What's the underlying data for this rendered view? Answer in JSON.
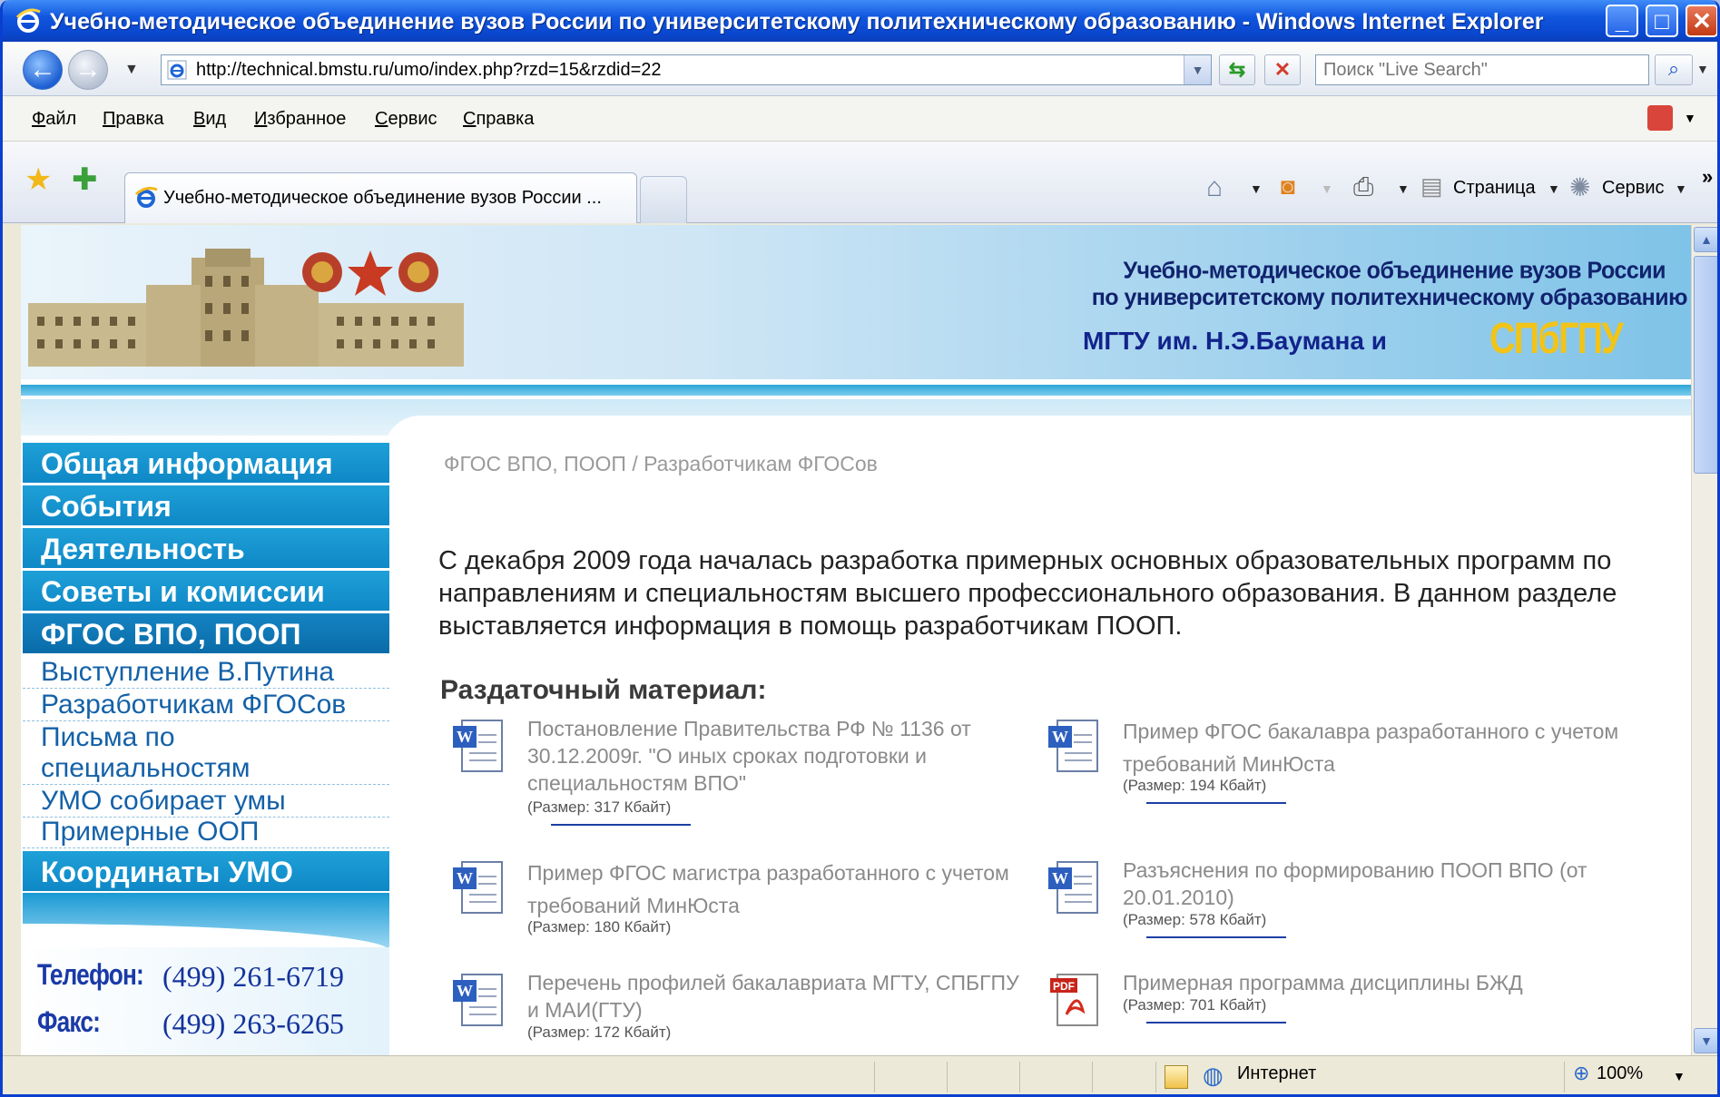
{
  "window": {
    "title": "Учебно-методическое объединение вузов России по университетскому политехническому образованию - Windows Internet Explorer",
    "min": "_",
    "max": "□",
    "close": "✕"
  },
  "address": {
    "url": "http://technical.bmstu.ru/umo/index.php?rzd=15&rzdid=22",
    "search_placeholder": "Поиск \"Live Search\""
  },
  "menu": [
    "Файл",
    "Правка",
    "Вид",
    "Избранное",
    "Сервис",
    "Справка"
  ],
  "tab": {
    "label": "Учебно-методическое объединение вузов России ..."
  },
  "commandbar": {
    "page": "Страница",
    "tools": "Сервис",
    "more": "»"
  },
  "banner": {
    "line1": "Учебно-методическое объединение вузов России",
    "line2": "по университетскому политехническому образованию",
    "line3": "МГТУ им. Н.Э.Баумана   и",
    "logo": "СПбГПУ"
  },
  "sidebar": {
    "nav": [
      "Общая информация",
      "События",
      "Деятельность",
      "Советы и комиссии",
      "ФГОС ВПО, ПООП"
    ],
    "sub": [
      "Выступление В.Путина",
      "Разработчикам ФГОСов",
      "Письма по",
      "специальностям",
      "УМО собирает умы",
      "Примерные ООП"
    ],
    "coords": "Координаты УМО",
    "phone_label": "Телефон:",
    "phone": "(499) 261-6719",
    "fax_label": "Факс:",
    "fax": "(499) 263-6265"
  },
  "main": {
    "breadcrumb": "ФГОС ВПО, ПООП / Разработчикам ФГОСов",
    "intro": "С декабря 2009 года началась разработка примерных основных образовательных программ по направлениям и специальностям высшего профессионального образования. В данном разделе выставляется информация в помощь разработчикам ПООП.",
    "materials_heading": "Раздаточный материал:",
    "docs": [
      {
        "title": "Постановление Правительства РФ № 1136 от 30.12.2009г. \"О иных сроках подготовки и специальностям ВПО\"",
        "size": "(Размер: 317 Кбайт)",
        "type": "word"
      },
      {
        "title": "Пример ФГОС бакалавра разработанного с учетом требований МинЮста",
        "size": "(Размер: 194 Кбайт)",
        "type": "word"
      },
      {
        "title": "Пример ФГОС магистра разработанного с учетом требований МинЮста",
        "size": "(Размер: 180 Кбайт)",
        "type": "word"
      },
      {
        "title": "Разъяснения по формированию ПООП ВПО (от 20.01.2010)",
        "size": "(Размер: 578 Кбайт)",
        "type": "word"
      },
      {
        "title": "Перечень профилей бакалавриата МГТУ, СПБГПУ и МАИ(ГТУ)",
        "size": "(Размер: 172 Кбайт)",
        "type": "word"
      },
      {
        "title": "Примерная программа дисциплины БЖД",
        "size": "(Размер: 701 Кбайт)",
        "type": "pdf"
      }
    ]
  },
  "status": {
    "zone": "Интернет",
    "zoom": "100%"
  },
  "colors": {
    "titlebar": "#0a47cf",
    "nav": "#1fa0d8",
    "sublink": "#1461a8",
    "banner_text": "#11226e",
    "logo": "#f2c418"
  }
}
